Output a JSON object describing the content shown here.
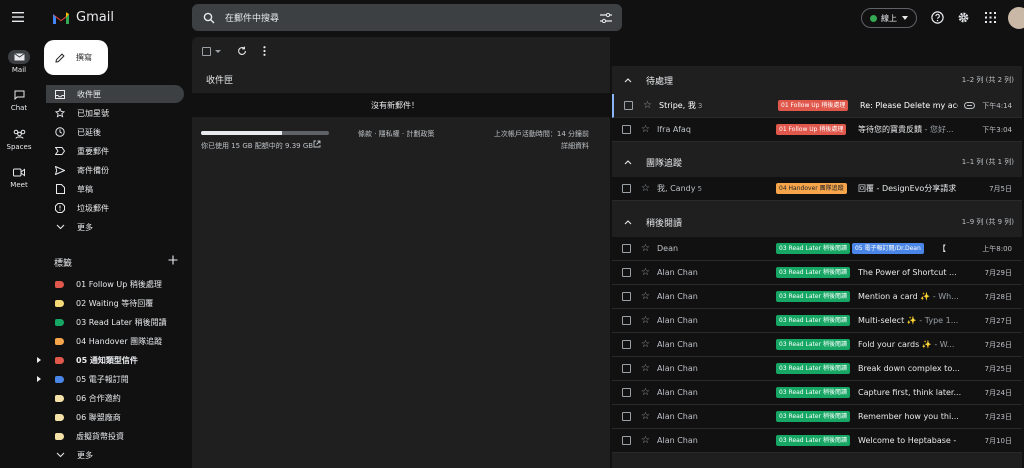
{
  "app": {
    "name": "Gmail"
  },
  "rail": [
    {
      "label": "Mail",
      "icon": "mail-icon",
      "active": true
    },
    {
      "label": "Chat",
      "icon": "chat-icon"
    },
    {
      "label": "Spaces",
      "icon": "spaces-icon"
    },
    {
      "label": "Meet",
      "icon": "meet-icon"
    }
  ],
  "compose": {
    "label": "撰寫"
  },
  "nav": {
    "items": [
      {
        "label": "收件匣",
        "icon": "inbox-icon",
        "active": true
      },
      {
        "label": "已加星號",
        "icon": "star-icon"
      },
      {
        "label": "已延後",
        "icon": "clock-icon"
      },
      {
        "label": "重要郵件",
        "icon": "important-icon"
      },
      {
        "label": "寄件備份",
        "icon": "send-icon"
      },
      {
        "label": "草稿",
        "icon": "draft-icon"
      },
      {
        "label": "垃圾郵件",
        "icon": "spam-icon"
      },
      {
        "label": "更多",
        "icon": "chevron-down-icon"
      }
    ],
    "labels_title": "標籤",
    "labels": [
      {
        "label": "01 Follow Up 稍後處理",
        "color": "#e0574b"
      },
      {
        "label": "02 Waiting 等待回覆",
        "color": "#f5d976"
      },
      {
        "label": "03 Read Later 稍後閱讀",
        "color": "#16a765"
      },
      {
        "label": "04 Handover 團隊追蹤",
        "color": "#f6a54a"
      },
      {
        "label": "05 通知類型信件",
        "color": "#e0574b",
        "bold": true,
        "caret": true
      },
      {
        "label": "05 電子報訂閱",
        "color": "#4a86e8",
        "caret": true
      },
      {
        "label": "06 合作邀約",
        "color": "#f5e2a8"
      },
      {
        "label": "06 聯盟廠商",
        "color": "#f5e2a8"
      },
      {
        "label": "虛擬貨幣投資",
        "color": "#f5e2a8"
      },
      {
        "label": "更多",
        "chevron": true
      }
    ]
  },
  "search": {
    "placeholder": "在郵件中搜尋"
  },
  "header": {
    "status": "線上"
  },
  "left": {
    "title": "收件匣",
    "empty": "沒有新郵件！",
    "storage_text": "你已使用 15 GB 配額中的 9.39 GB",
    "storage_fraction": 0.63,
    "terms": "條款 · 隱私權 · 計劃政策",
    "last_activity": "上次帳戶活動時間：14 分鐘前",
    "details": "詳細資料"
  },
  "sections": [
    {
      "title": "待處理",
      "count": "1–2 列 (共 2 列)",
      "rows": [
        {
          "sender": "Stripe, 我",
          "count": "3",
          "tags": [
            {
              "text": "01 Follow Up 稍後處理",
              "color": "#e0574b"
            }
          ],
          "subject": "Re: Please Delete my acc...",
          "snippet": "",
          "date": "下午4:14",
          "starred": false,
          "unread": true,
          "selected": true,
          "attach": true
        },
        {
          "sender": "Ifra Afaq",
          "count": "",
          "tags": [
            {
              "text": "01 Follow Up 稍後處理",
              "color": "#e0574b"
            }
          ],
          "subject": "等待您的寶貴反饋",
          "snippet": " - 您好...",
          "date": "下午3:04",
          "unread": false
        }
      ]
    },
    {
      "title": "團隊追蹤",
      "count": "1–1 列 (共 1 列)",
      "rows": [
        {
          "sender": "我, Candy",
          "count": "5",
          "tags": [
            {
              "text": "04 Handover 團隊追蹤",
              "color": "#f6a54a"
            }
          ],
          "subject": "回覆 - DesignEvo分享請求",
          "snippet": "",
          "date": "7月5日",
          "unread": false
        }
      ]
    },
    {
      "title": "稍後閱讀",
      "count": "1–9 列 (共 9 列)",
      "rows": [
        {
          "sender": "Dean",
          "count": "",
          "tags": [
            {
              "text": "03 Read Later 稍後閱讀",
              "color": "#16a765"
            },
            {
              "text": "05 電子報訂閱/Dr.Dean",
              "color": "#4a86e8"
            }
          ],
          "subject": "【",
          "snippet": "",
          "date": "上午8:00",
          "unread": false
        },
        {
          "sender": "Alan Chan",
          "count": "",
          "tags": [
            {
              "text": "03 Read Later 稍後閱讀",
              "color": "#16a765"
            }
          ],
          "subject": "The Power of Shortcut ...",
          "snippet": "",
          "date": "7月29日",
          "unread": false
        },
        {
          "sender": "Alan Chan",
          "count": "",
          "tags": [
            {
              "text": "03 Read Later 稍後閱讀",
              "color": "#16a765"
            }
          ],
          "subject": "Mention a card ✨",
          "snippet": " - Wh...",
          "date": "7月28日",
          "unread": false
        },
        {
          "sender": "Alan Chan",
          "count": "",
          "tags": [
            {
              "text": "03 Read Later 稍後閱讀",
              "color": "#16a765"
            }
          ],
          "subject": "Multi-select ✨",
          "snippet": " - Type 1...",
          "date": "7月27日",
          "unread": false
        },
        {
          "sender": "Alan Chan",
          "count": "",
          "tags": [
            {
              "text": "03 Read Later 稍後閱讀",
              "color": "#16a765"
            }
          ],
          "subject": "Fold your cards ✨",
          "snippet": " - W...",
          "date": "7月26日",
          "unread": false
        },
        {
          "sender": "Alan Chan",
          "count": "",
          "tags": [
            {
              "text": "03 Read Later 稍後閱讀",
              "color": "#16a765"
            }
          ],
          "subject": "Break down complex to...",
          "snippet": "",
          "date": "7月25日",
          "unread": false
        },
        {
          "sender": "Alan Chan",
          "count": "",
          "tags": [
            {
              "text": "03 Read Later 稍後閱讀",
              "color": "#16a765"
            }
          ],
          "subject": "Capture first, think later...",
          "snippet": "",
          "date": "7月24日",
          "unread": false
        },
        {
          "sender": "Alan Chan",
          "count": "",
          "tags": [
            {
              "text": "03 Read Later 稍後閱讀",
              "color": "#16a765"
            }
          ],
          "subject": "Remember how you thi...",
          "snippet": "",
          "date": "7月23日",
          "unread": false
        },
        {
          "sender": "Alan Chan",
          "count": "",
          "tags": [
            {
              "text": "03 Read Later 稍後閱讀",
              "color": "#16a765"
            }
          ],
          "subject": "Welcome to Heptabase -",
          "snippet": "",
          "date": "7月10日",
          "unread": false
        }
      ]
    }
  ]
}
